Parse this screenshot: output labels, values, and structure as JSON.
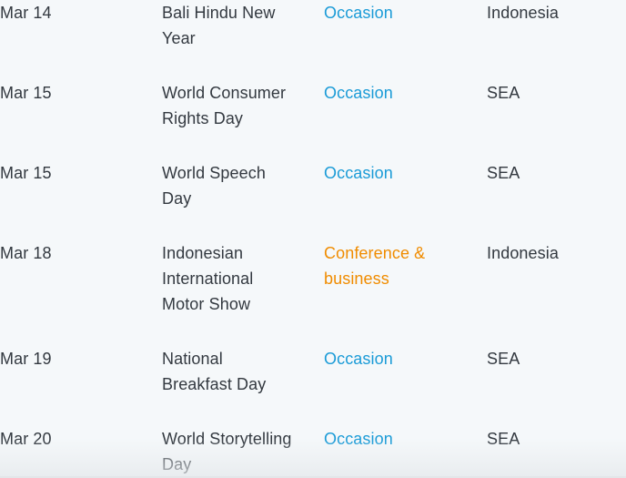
{
  "events": [
    {
      "date": "Mar 14",
      "name_lines": [
        "Bali Hindu New",
        "Year"
      ],
      "category_lines": [
        "Occasion"
      ],
      "category_type": "occasion",
      "region": "Indonesia"
    },
    {
      "date": "Mar 15",
      "name_lines": [
        "World Consumer",
        "Rights Day"
      ],
      "category_lines": [
        "Occasion"
      ],
      "category_type": "occasion",
      "region": "SEA"
    },
    {
      "date": "Mar 15",
      "name_lines": [
        "World Speech",
        "Day"
      ],
      "category_lines": [
        "Occasion"
      ],
      "category_type": "occasion",
      "region": "SEA"
    },
    {
      "date": "Mar 18",
      "name_lines": [
        "Indonesian",
        "International",
        "Motor Show"
      ],
      "category_lines": [
        "Conference &",
        "business"
      ],
      "category_type": "conference",
      "region": "Indonesia"
    },
    {
      "date": "Mar 19",
      "name_lines": [
        "National",
        "Breakfast Day"
      ],
      "category_lines": [
        "Occasion"
      ],
      "category_type": "occasion",
      "region": "SEA"
    },
    {
      "date": "Mar 20",
      "name_lines": [
        "World Storytelling",
        "Day"
      ],
      "category_lines": [
        "Occasion"
      ],
      "category_type": "occasion",
      "region": "SEA"
    }
  ],
  "colors": {
    "occasion": "#1a9bd7",
    "conference": "#f08c00",
    "text": "#333940",
    "background": "#f5f8fa"
  }
}
